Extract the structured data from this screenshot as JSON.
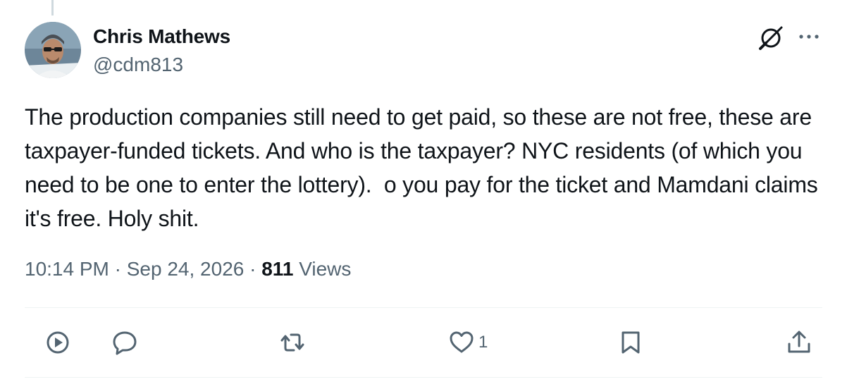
{
  "author": {
    "name": "Chris Mathews",
    "handle": "@cdm813"
  },
  "tweet": {
    "text": "The production companies still need to get paid, so these are not free, these are taxpayer-funded tickets. And who is the taxpayer? NYC residents (of which you need to be one to enter the lottery).  o you pay for the ticket and Mamdani claims it's free. Holy shit."
  },
  "meta": {
    "time": "10:14 PM",
    "separator": "·",
    "date": "Sep 24, 2026",
    "views_count": "811",
    "views_label": "Views"
  },
  "actions": {
    "like_count": "1"
  },
  "icons": {
    "top_right": [
      "grok-icon",
      "more-icon"
    ],
    "action_bar": [
      "play-icon",
      "reply-icon",
      "repost-icon",
      "like-icon",
      "bookmark-icon",
      "share-icon"
    ]
  },
  "colors": {
    "text_primary": "#0f1419",
    "text_secondary": "#536471",
    "divider": "#eff3f4",
    "thread_line": "#cfd9de"
  }
}
